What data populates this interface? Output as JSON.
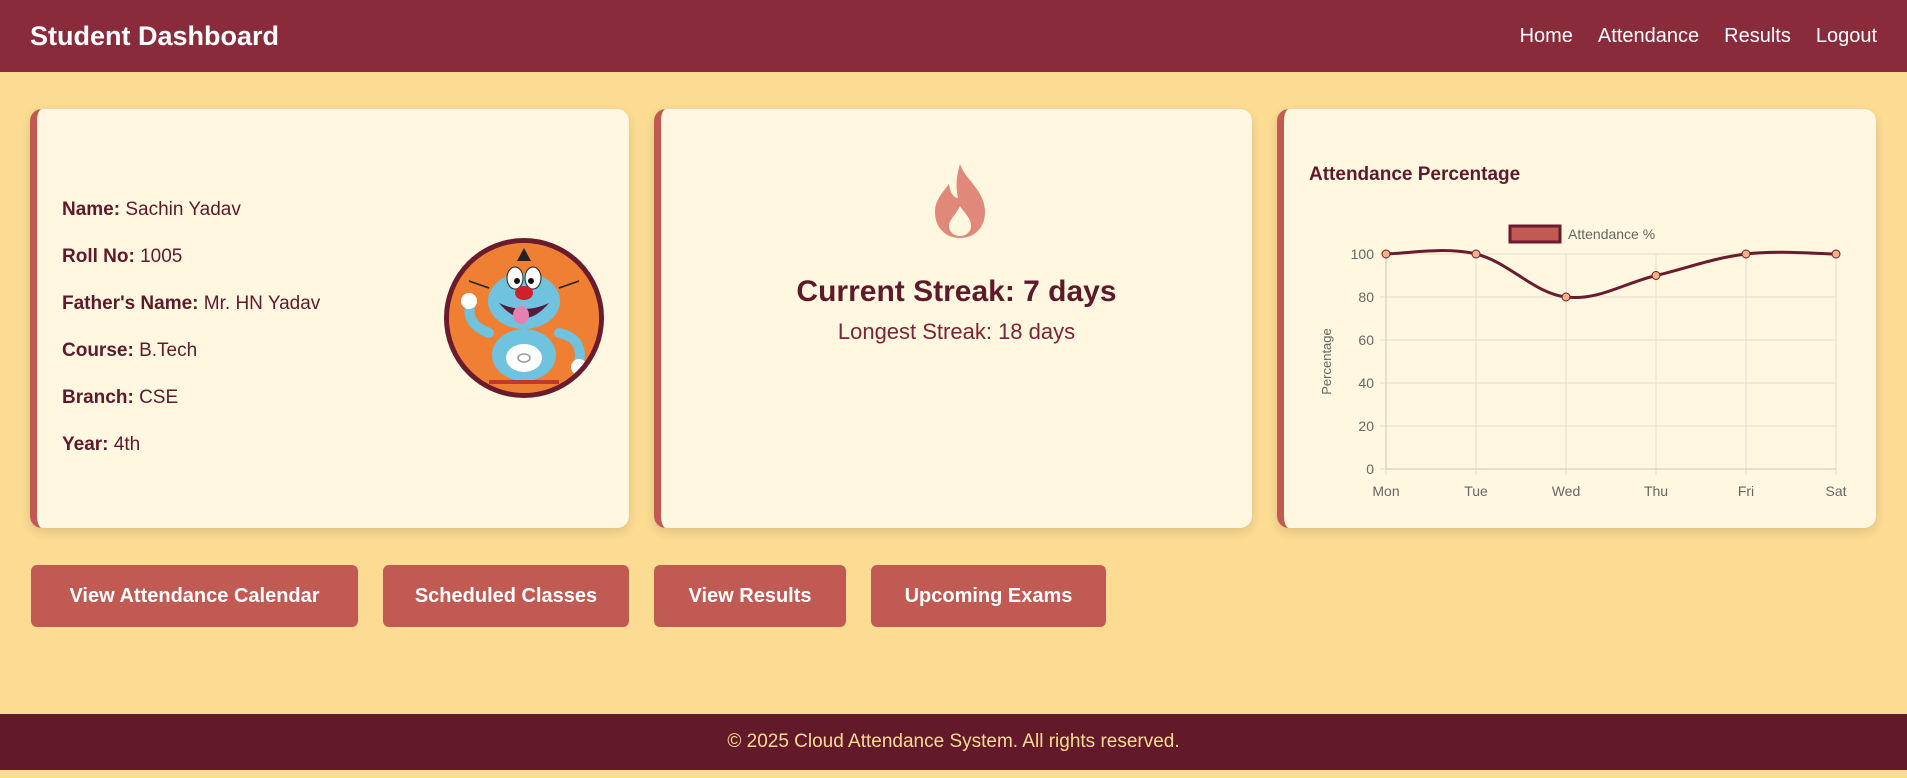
{
  "navbar": {
    "brand": "Student Dashboard",
    "links": [
      "Home",
      "Attendance",
      "Results",
      "Logout"
    ]
  },
  "profile": {
    "fields": [
      {
        "key": "Name:",
        "value": "Sachin Yadav"
      },
      {
        "key": "Roll No:",
        "value": "1005"
      },
      {
        "key": "Father's Name:",
        "value": "Mr. HN Yadav"
      },
      {
        "key": "Course:",
        "value": "B.Tech"
      },
      {
        "key": "Branch:",
        "value": "CSE"
      },
      {
        "key": "Year:",
        "value": "4th"
      }
    ]
  },
  "streak": {
    "icon": "fire-icon",
    "current": "Current Streak: 7 days",
    "longest": "Longest Streak: 18 days"
  },
  "chart_data": {
    "type": "line",
    "title": "Attendance Percentage",
    "categories": [
      "Mon",
      "Tue",
      "Wed",
      "Thu",
      "Fri",
      "Sat"
    ],
    "series": [
      {
        "name": "Attendance %",
        "values": [
          100,
          100,
          80,
          90,
          100,
          100
        ]
      }
    ],
    "ylabel": "Percentage",
    "ylim": [
      0,
      100
    ],
    "yticks": [
      0,
      20,
      40,
      60,
      80,
      100
    ],
    "grid": true,
    "legend": "top",
    "colors": {
      "line": "#6a1b2e",
      "fill": "#c05a52",
      "point": "#f4b183"
    }
  },
  "actions": {
    "calendar": "View Attendance Calendar",
    "classes": "Scheduled Classes",
    "results": "View Results",
    "exams": "Upcoming Exams"
  },
  "footer": {
    "text": "© 2025 Cloud Attendance System. All rights reserved."
  }
}
